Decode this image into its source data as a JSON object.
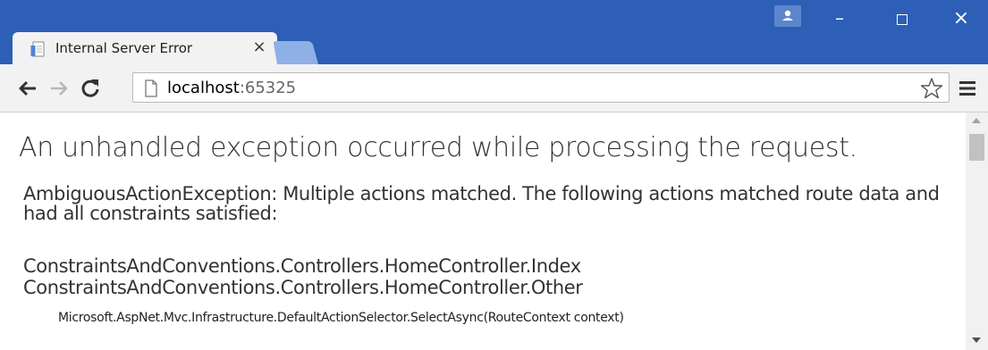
{
  "browser": {
    "tab": {
      "title": "Internal Server Error",
      "close_glyph": "×",
      "favicon": "page-icon"
    },
    "window_controls": {
      "minimize": "–",
      "close": "×"
    },
    "address_bar": {
      "host": "localhost",
      "port": ":65325"
    },
    "colors": {
      "titlebar": "#2c5fb5",
      "toolbar": "#f2f2f2"
    }
  },
  "page": {
    "heading": "An unhandled exception occurred while processing the request.",
    "exception_message": "AmbiguousActionException: Multiple actions matched. The following actions matched route data and had all constraints satisfied:",
    "matched_actions": [
      "ConstraintsAndConventions.Controllers.HomeController.Index",
      "ConstraintsAndConventions.Controllers.HomeController.Other"
    ],
    "stack_frame": "Microsoft.AspNet.Mvc.Infrastructure.DefaultActionSelector.SelectAsync(RouteContext context)"
  }
}
